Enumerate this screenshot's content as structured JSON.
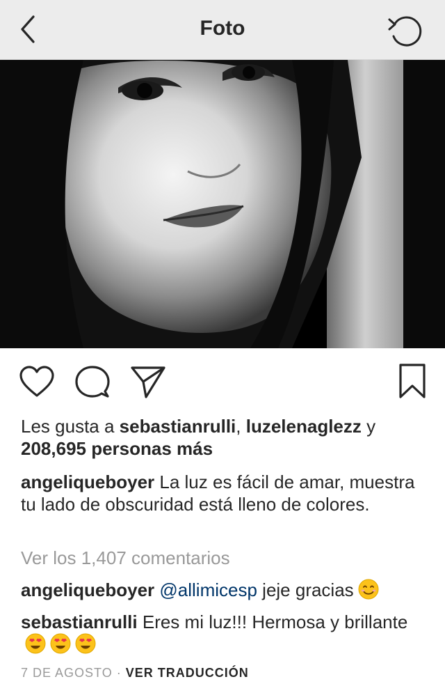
{
  "header": {
    "title": "Foto",
    "back_icon": "chevron-left-icon",
    "refresh_icon": "refresh-icon"
  },
  "photo": {
    "description": "black-and-white-portrait"
  },
  "actions": {
    "like_icon": "heart-icon",
    "comment_icon": "comment-icon",
    "share_icon": "send-icon",
    "save_icon": "bookmark-icon"
  },
  "likes": {
    "prefix": "Les gusta a ",
    "user1": "sebastianrulli",
    "separator": ", ",
    "user2": "luzelenaglezz",
    "conjunction": " y ",
    "others": "208,695 personas más"
  },
  "caption": {
    "username": "angeliqueboyer",
    "text": " La luz es fácil de amar, muestra tu lado de obscuridad está lleno de colores."
  },
  "view_comments": "Ver los 1,407 comentarios",
  "comments": [
    {
      "username": "angeliqueboyer",
      "mention": "@allimicesp",
      "text": " jeje gracias"
    },
    {
      "username": "sebastianrulli",
      "text": " Eres mi luz!!! Hermosa y brillante"
    }
  ],
  "meta": {
    "date": "7 DE AGOSTO",
    "dot": " · ",
    "translate": "VER TRADUCCIÓN"
  },
  "colors": {
    "header_bg": "#ececec",
    "text": "#262626",
    "muted": "#999999",
    "mention": "#003569"
  }
}
